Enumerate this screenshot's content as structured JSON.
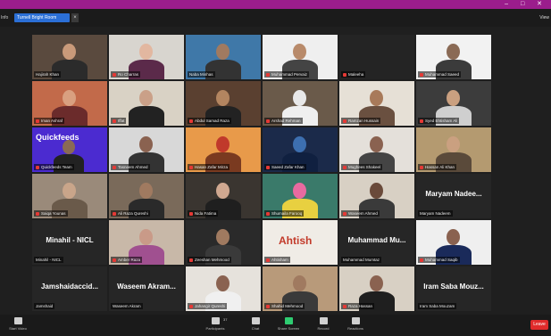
{
  "window": {
    "controls": "– □ ✕"
  },
  "topbar": {
    "left_label": "Info",
    "meeting_label": "Turnell Bright Room",
    "close_label": "×",
    "view_label": "View"
  },
  "tiles": [
    {
      "label": "Hajirah Khan",
      "muted": false,
      "bg": "#5a4a3e",
      "skin": "#c99a7a",
      "shirt": "#2b2b2b"
    },
    {
      "label": "Ro Charras",
      "muted": true,
      "bg": "#d8d5cf",
      "skin": "#e2b7a0",
      "shirt": "#5b2a4a"
    },
    {
      "label": "Naba Minhas",
      "muted": false,
      "bg": "#3f78a8",
      "skin": "#a07a60",
      "shirt": "#333",
      "active": true
    },
    {
      "label": "Muhammad Pervaiz",
      "muted": true,
      "bg": "#efefef",
      "skin": "#b88a6a",
      "shirt": "#444"
    },
    {
      "label": "Maleeha",
      "muted": true,
      "bg": "#242424",
      "skin": "#242424",
      "shirt": "#242424",
      "empty": true
    },
    {
      "label": "Muhammad Saeed",
      "muted": true,
      "bg": "#f2f2f2",
      "skin": "#8a6a55",
      "shirt": "#3b3b3b"
    },
    {
      "label": "Iman Ashraf",
      "muted": true,
      "bg": "#c26a4a",
      "skin": "#d9a080",
      "shirt": "#6b2b2b"
    },
    {
      "label": "Iffat",
      "muted": true,
      "bg": "#d9d2c5",
      "skin": "#caa088",
      "shirt": "#222"
    },
    {
      "label": "Abdul Samad Raza",
      "muted": true,
      "bg": "#5a4030",
      "skin": "#b38560",
      "shirt": "#222"
    },
    {
      "label": "Arshad Rehman",
      "muted": true,
      "bg": "#6a5a4a",
      "skin": "#e8e8e8",
      "shirt": "#efefef"
    },
    {
      "label": "Ramzan Hussain",
      "muted": true,
      "bg": "#e6e0d6",
      "skin": "#a87a5a",
      "shirt": "#6a5040"
    },
    {
      "label": "Syed Ehtisham Ali",
      "muted": true,
      "bg": "#3c3c3c",
      "skin": "#caa080",
      "shirt": "#cfcfcf"
    },
    {
      "label": "Quickfeeds Team",
      "muted": true,
      "bg": "#4b2bd0",
      "skin": "#8a6a55",
      "shirt": "#222",
      "logo": "Quickfeeds"
    },
    {
      "label": "Tasneem Ahmed",
      "muted": true,
      "bg": "#d8d8d8",
      "skin": "#8a6250",
      "shirt": "#333"
    },
    {
      "label": "Hasan Zafar Mirza",
      "muted": true,
      "bg": "#e89a4a",
      "skin": "#c0392b",
      "shirt": "#7a3a20"
    },
    {
      "label": "Saeed Zafar Khan",
      "muted": true,
      "bg": "#1b2a4a",
      "skin": "#3d6fb0",
      "shirt": "#102040"
    },
    {
      "label": "Mughees Shakeel",
      "muted": true,
      "bg": "#e4e0da",
      "skin": "#8a6250",
      "shirt": "#444"
    },
    {
      "label": "Hassan Ali Khan",
      "muted": true,
      "bg": "#b49a70",
      "skin": "#caa080",
      "shirt": "#5a4a3a"
    },
    {
      "label": "Saiqa Younas",
      "muted": true,
      "bg": "#9a8a7a",
      "skin": "#c9a58a",
      "shirt": "#6a5a4a"
    },
    {
      "label": "Ali Raza Qureshi",
      "muted": true,
      "bg": "#7a6a5a",
      "skin": "#a07a60",
      "shirt": "#2a2a2a"
    },
    {
      "label": "Nida Fatima",
      "muted": true,
      "bg": "#3a3530",
      "skin": "#d0a890",
      "shirt": "#1f1f1f"
    },
    {
      "label": "Shumaila Farooq",
      "muted": true,
      "bg": "#3a7a6a",
      "skin": "#e86aa0",
      "shirt": "#e8d040"
    },
    {
      "label": "Waseem Ahmed",
      "muted": true,
      "bg": "#d8d0c4",
      "skin": "#6a4a3a",
      "shirt": "#3a3a3a"
    },
    {
      "label": "Maryam Nadeem",
      "muted": false,
      "bg": "#262626",
      "big": "Maryam Nadee..."
    },
    {
      "label": "Minahil - NICL",
      "muted": false,
      "bg": "#262626",
      "big": "Minahil - NICL"
    },
    {
      "label": "Amber Raza",
      "muted": true,
      "bg": "#c8b8a8",
      "skin": "#c99a88",
      "shirt": "#a05090"
    },
    {
      "label": "Zeeshan Mehmood",
      "muted": true,
      "bg": "#2a2a2a",
      "skin": "#a07a60",
      "shirt": "#3a3a3a"
    },
    {
      "label": "Ahtisham",
      "muted": true,
      "bg": "#f0ece6",
      "logo": "Ahtish"
    },
    {
      "label": "Muhammad Mumtaz",
      "muted": false,
      "bg": "#262626",
      "big": "Muhammad Mu..."
    },
    {
      "label": "Muhammad Saqib",
      "muted": true,
      "bg": "#efefef",
      "skin": "#8a6250",
      "shirt": "#1a2a5a"
    },
    {
      "label": "Jamshaid",
      "muted": false,
      "bg": "#262626",
      "big": "Jamshaidaccid..."
    },
    {
      "label": "Waseem Akram",
      "muted": false,
      "bg": "#262626",
      "big": "Waseem Akram..."
    },
    {
      "label": "Jahangir Qureshi",
      "muted": true,
      "bg": "#e6e2dc",
      "skin": "#8a6250",
      "shirt": "#f0f0f0"
    },
    {
      "label": "Shahid Mehmood",
      "muted": true,
      "bg": "#b89a7a",
      "skin": "#a07a60",
      "shirt": "#3a3a3a"
    },
    {
      "label": "Raza Hassan",
      "muted": true,
      "bg": "#d8d0c4",
      "skin": "#8a6250",
      "shirt": "#1f1f1f"
    },
    {
      "label": "Iram Saba Mouzam",
      "muted": false,
      "bg": "#262626",
      "big": "Iram Saba Mouz..."
    }
  ],
  "toolbar": {
    "start_video": "Start Video",
    "participants": "Participants",
    "participants_count": "37",
    "chat": "Chat",
    "share_screen": "Share Screen",
    "record": "Record",
    "reactions": "Reactions",
    "end": "Leave"
  },
  "colors": {
    "titlebar": "#9b1d8c",
    "pill": "#2b6fd6",
    "active_speaker": "#e6e02a",
    "end": "#e02b2b"
  }
}
